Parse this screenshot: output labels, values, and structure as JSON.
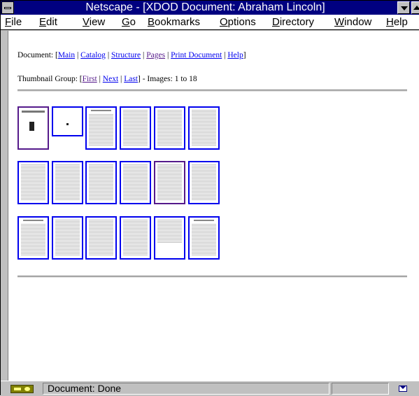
{
  "window": {
    "title": "Netscape - [XDOD Document: Abraham Lincoln]"
  },
  "menubar": {
    "items": [
      {
        "underline": "F",
        "rest": "ile"
      },
      {
        "underline": "E",
        "rest": "dit"
      },
      {
        "underline": "V",
        "rest": "iew"
      },
      {
        "underline": "G",
        "rest": "o"
      },
      {
        "underline": "B",
        "rest": "ookmarks"
      },
      {
        "underline": "O",
        "rest": "ptions"
      },
      {
        "underline": "D",
        "rest": "irectory"
      },
      {
        "underline": "W",
        "rest": "indow"
      },
      {
        "underline": "H",
        "rest": "elp"
      }
    ]
  },
  "document_nav": {
    "prefix": "Document: [",
    "links": [
      "Main",
      "Catalog",
      "Structure",
      "Pages",
      "Print Document",
      "Help"
    ],
    "separator": " | ",
    "suffix": "]"
  },
  "thumbnail_nav": {
    "prefix": "Thumbnail Group: [",
    "links": [
      "First",
      "Next",
      "Last"
    ],
    "separator": " | ",
    "suffix": "] - Images: 1 to 18"
  },
  "thumbnails": {
    "count": 18,
    "visited_indices": [
      0,
      10
    ]
  },
  "statusbar": {
    "text": "Document: Done"
  },
  "colors": {
    "link": "#0000ee",
    "visited_link": "#551a8b",
    "title_bar": "#000080"
  }
}
